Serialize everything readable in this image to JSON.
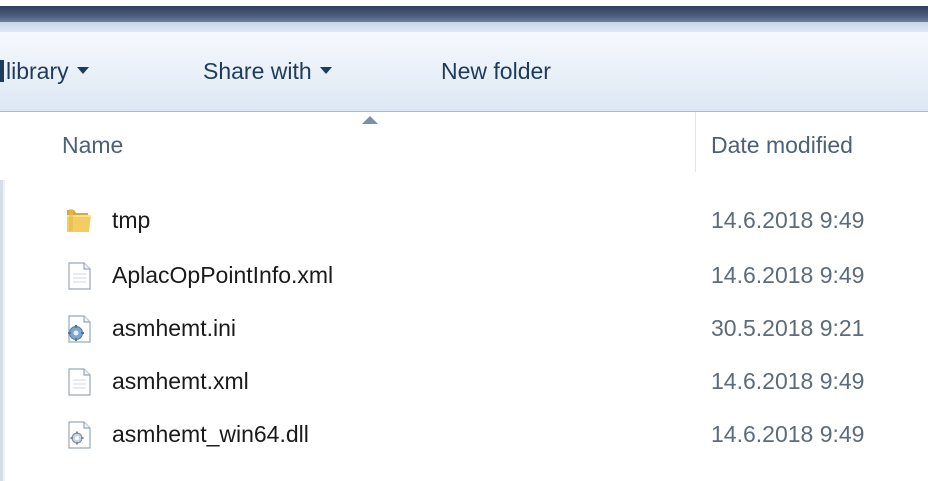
{
  "toolbar": {
    "include_label": "library",
    "share_label": "Share with",
    "new_folder_label": "New folder"
  },
  "columns": {
    "name": "Name",
    "date_modified": "Date modified"
  },
  "files": [
    {
      "name": "tmp",
      "date": "14.6.2018 9:49",
      "icon": "folder-icon"
    },
    {
      "name": "AplacOpPointInfo.xml",
      "date": "14.6.2018 9:49",
      "icon": "document-icon"
    },
    {
      "name": "asmhemt.ini",
      "date": "30.5.2018 9:21",
      "icon": "settings-file-icon"
    },
    {
      "name": "asmhemt.xml",
      "date": "14.6.2018 9:49",
      "icon": "document-icon"
    },
    {
      "name": "asmhemt_win64.dll",
      "date": "14.6.2018 9:49",
      "icon": "dll-file-icon"
    }
  ]
}
